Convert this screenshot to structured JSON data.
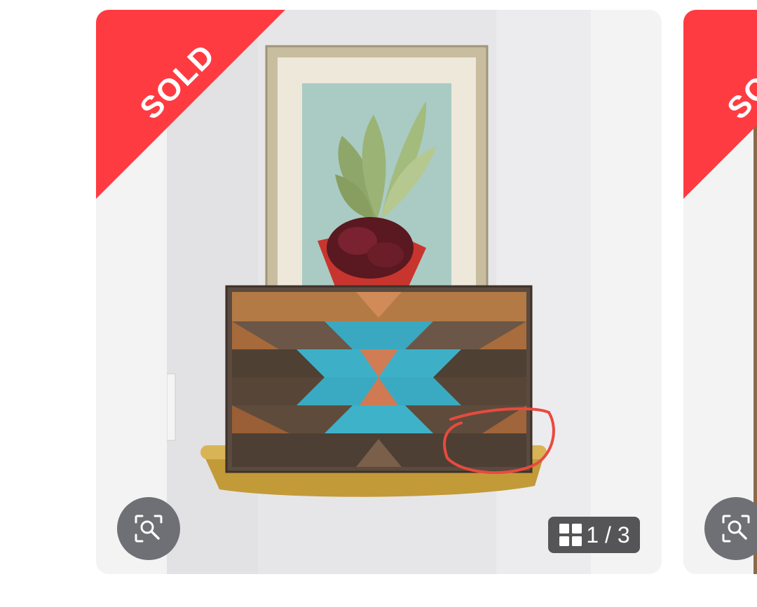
{
  "colors": {
    "sold_red": "#ff3b42",
    "card_bg": "#f3f3f4",
    "control_bg": "#6f7075",
    "counter_bg": "#555558"
  },
  "gallery": {
    "main_card": {
      "sold_badge": "SOLD",
      "zoom_icon": "zoom-scan-icon",
      "counter_icon": "grid-icon",
      "counter_text": "1 / 3"
    },
    "next_card": {
      "sold_badge": "SOLD",
      "zoom_icon": "zoom-scan-icon"
    }
  }
}
